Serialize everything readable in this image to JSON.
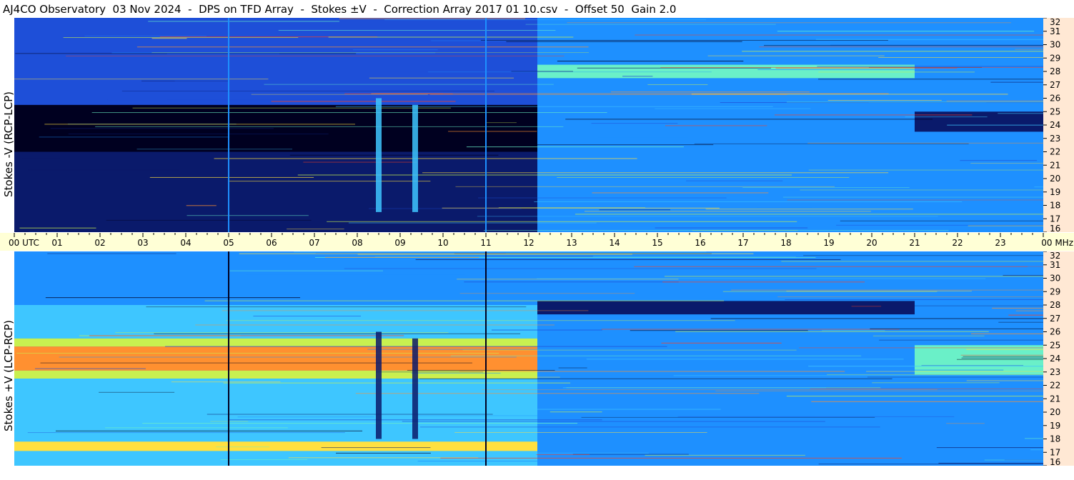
{
  "header": {
    "title": "AJ4CO Observatory  03 Nov 2024  -  DPS on TFD Array  -  Stokes ±V  -  Correction Array 2017 01 10.csv  -  Offset 50  Gain 2.0"
  },
  "colors": {
    "top_background": "#0a1a6b",
    "bottom_background": "#1e90ff",
    "freq_axis_bg": "#ffe8d4",
    "time_axis_bg": "#ffffd6",
    "palette": [
      "#000020",
      "#0a1a6b",
      "#1e4fd8",
      "#1e90ff",
      "#3ec6ff",
      "#6af0c8",
      "#c8f050",
      "#ffe040",
      "#ff9030",
      "#ff4020"
    ]
  },
  "chart_data": [
    {
      "type": "heatmap",
      "panel": "top",
      "ylabel": "Stokes -V (RCP-LCP)",
      "x_ticks": [
        "00 UTC",
        "01",
        "02",
        "03",
        "04",
        "05",
        "06",
        "07",
        "08",
        "09",
        "10",
        "11",
        "12",
        "13",
        "14",
        "15",
        "16",
        "17",
        "18",
        "19",
        "20",
        "21",
        "22",
        "23",
        "00 MHz"
      ],
      "xlim_hours": [
        0,
        24
      ],
      "ylim_mhz": [
        16,
        32
      ],
      "y_ticks": [
        "32",
        "31",
        "30",
        "29",
        "28",
        "27",
        "26",
        "25",
        "24",
        "23",
        "22",
        "21",
        "20",
        "19",
        "18",
        "17",
        "16"
      ],
      "regions": [
        {
          "t_start": 0.0,
          "t_end": 12.2,
          "f_start": 24.5,
          "f_end": 32,
          "level": 2
        },
        {
          "t_start": 0.0,
          "t_end": 12.2,
          "f_start": 22.0,
          "f_end": 25.5,
          "level": 0
        },
        {
          "t_start": 0.0,
          "t_end": 12.2,
          "f_start": 16,
          "f_end": 22.0,
          "level": 1
        },
        {
          "t_start": 12.2,
          "t_end": 21.0,
          "f_start": 16,
          "f_end": 32,
          "level": 3
        },
        {
          "t_start": 21.0,
          "t_end": 24.0,
          "f_start": 16,
          "f_end": 32,
          "level": 3
        },
        {
          "t_start": 21.0,
          "t_end": 24.0,
          "f_start": 23.5,
          "f_end": 25.0,
          "level": 1
        },
        {
          "t_start": 12.2,
          "t_end": 21.0,
          "f_start": 27.5,
          "f_end": 28.5,
          "level": 5
        }
      ],
      "bursts": [
        {
          "t": 8.5,
          "f_start": 17.5,
          "f_end": 26,
          "level": 4
        },
        {
          "t": 9.35,
          "f_start": 17.5,
          "f_end": 25.5,
          "level": 4
        }
      ],
      "vertical_markers": [
        {
          "t": 5.0,
          "level": 3
        },
        {
          "t": 11.0,
          "level": 3
        }
      ]
    },
    {
      "type": "heatmap",
      "panel": "bottom",
      "ylabel": "Stokes +V (LCP-RCP)",
      "xlim_hours": [
        0,
        24
      ],
      "ylim_mhz": [
        16,
        32
      ],
      "y_ticks": [
        "32",
        "31",
        "30",
        "29",
        "28",
        "27",
        "26",
        "25",
        "24",
        "23",
        "22",
        "21",
        "20",
        "19",
        "18",
        "17",
        "16"
      ],
      "regions": [
        {
          "t_start": 0.0,
          "t_end": 12.2,
          "f_start": 28,
          "f_end": 32,
          "level": 3
        },
        {
          "t_start": 0.0,
          "t_end": 12.2,
          "f_start": 25.5,
          "f_end": 28,
          "level": 4
        },
        {
          "t_start": 0.0,
          "t_end": 12.2,
          "f_start": 24.9,
          "f_end": 25.5,
          "level": 6
        },
        {
          "t_start": 0.0,
          "t_end": 12.2,
          "f_start": 23.1,
          "f_end": 24.9,
          "level": 8
        },
        {
          "t_start": 0.0,
          "t_end": 12.2,
          "f_start": 22.5,
          "f_end": 23.1,
          "level": 6
        },
        {
          "t_start": 0.0,
          "t_end": 12.2,
          "f_start": 16,
          "f_end": 22.5,
          "level": 4
        },
        {
          "t_start": 0.0,
          "t_end": 12.2,
          "f_start": 17.1,
          "f_end": 17.8,
          "level": 7
        },
        {
          "t_start": 12.2,
          "t_end": 21.0,
          "f_start": 16,
          "f_end": 32,
          "level": 3
        },
        {
          "t_start": 21.0,
          "t_end": 24.0,
          "f_start": 16,
          "f_end": 32,
          "level": 3
        },
        {
          "t_start": 21.0,
          "t_end": 24.0,
          "f_start": 22.8,
          "f_end": 25.0,
          "level": 5
        },
        {
          "t_start": 12.2,
          "t_end": 21.0,
          "f_start": 27.3,
          "f_end": 28.3,
          "level": 1
        }
      ],
      "bursts": [
        {
          "t": 8.5,
          "f_start": 18,
          "f_end": 26,
          "level": 1
        },
        {
          "t": 9.35,
          "f_start": 18,
          "f_end": 25.5,
          "level": 1
        }
      ],
      "vertical_markers": [
        {
          "t": 5.0,
          "level": 0
        },
        {
          "t": 11.0,
          "level": 0
        }
      ]
    }
  ]
}
